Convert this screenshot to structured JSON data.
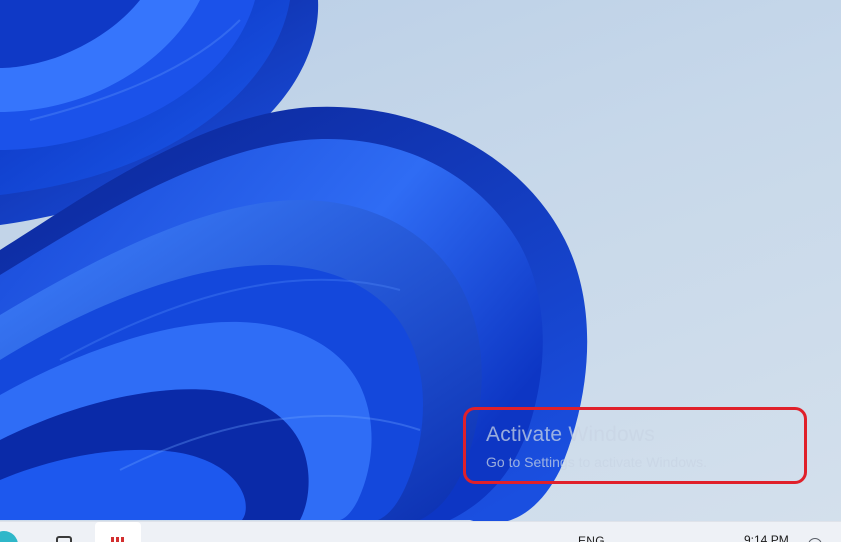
{
  "watermark": {
    "title": "Activate Windows",
    "subtitle": "Go to Settings to activate Windows."
  },
  "taskbar": {
    "language": "ENG",
    "time": "9:14 PM",
    "icons": [
      "start-icon",
      "task-view-icon",
      "pinned-app-icon",
      "notification-icon"
    ]
  },
  "colors": {
    "highlight": "#e0202a",
    "wallpaper_blue": "#1646d8",
    "desktop_background": "#c7d8ea",
    "taskbar": "#eef1f6"
  }
}
